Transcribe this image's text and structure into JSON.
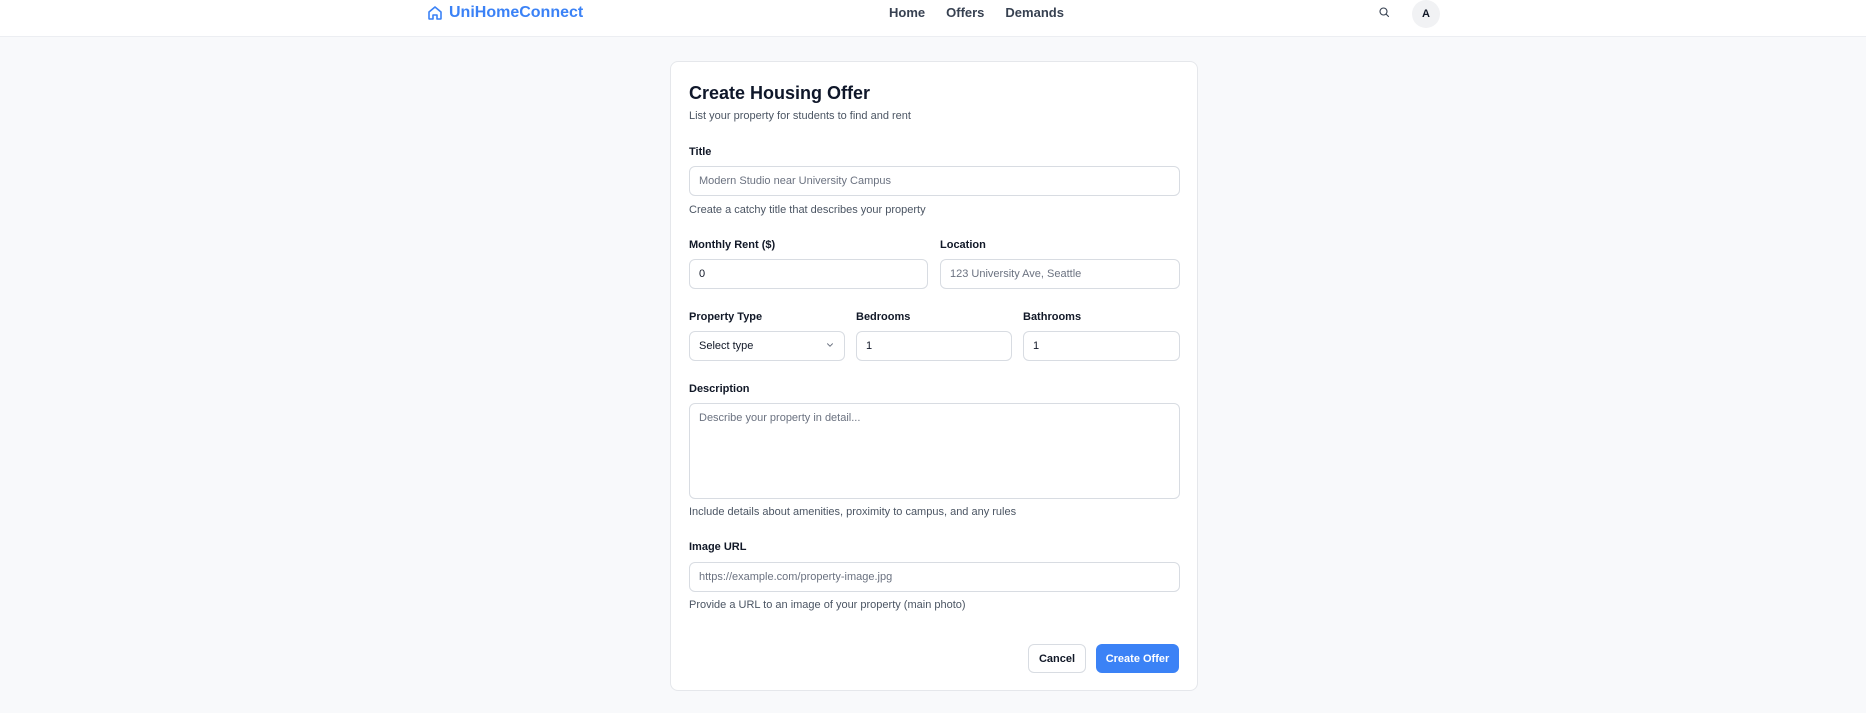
{
  "header": {
    "brand": "UniHomeConnect",
    "nav": [
      "Home",
      "Offers",
      "Demands"
    ],
    "avatar_initial": "A",
    "brand_color": "#3b82f6"
  },
  "form": {
    "title": "Create Housing Offer",
    "subtitle": "List your property for students to find and rent",
    "title_field": {
      "label": "Title",
      "placeholder": "Modern Studio near University Campus",
      "hint": "Create a catchy title that describes your property"
    },
    "rent_field": {
      "label": "Monthly Rent ($)",
      "value": "0"
    },
    "location_field": {
      "label": "Location",
      "placeholder": "123 University Ave, Seattle"
    },
    "property_type_field": {
      "label": "Property Type",
      "selected": "Select type"
    },
    "bedrooms_field": {
      "label": "Bedrooms",
      "value": "1"
    },
    "bathrooms_field": {
      "label": "Bathrooms",
      "value": "1"
    },
    "description_field": {
      "label": "Description",
      "placeholder": "Describe your property in detail...",
      "hint": "Include details about amenities, proximity to campus, and any rules"
    },
    "image_field": {
      "label": "Image URL",
      "placeholder": "https://example.com/property-image.jpg",
      "hint": "Provide a URL to an image of your property (main photo)"
    },
    "cancel_label": "Cancel",
    "submit_label": "Create Offer",
    "primary_color": "#3b82f6"
  }
}
